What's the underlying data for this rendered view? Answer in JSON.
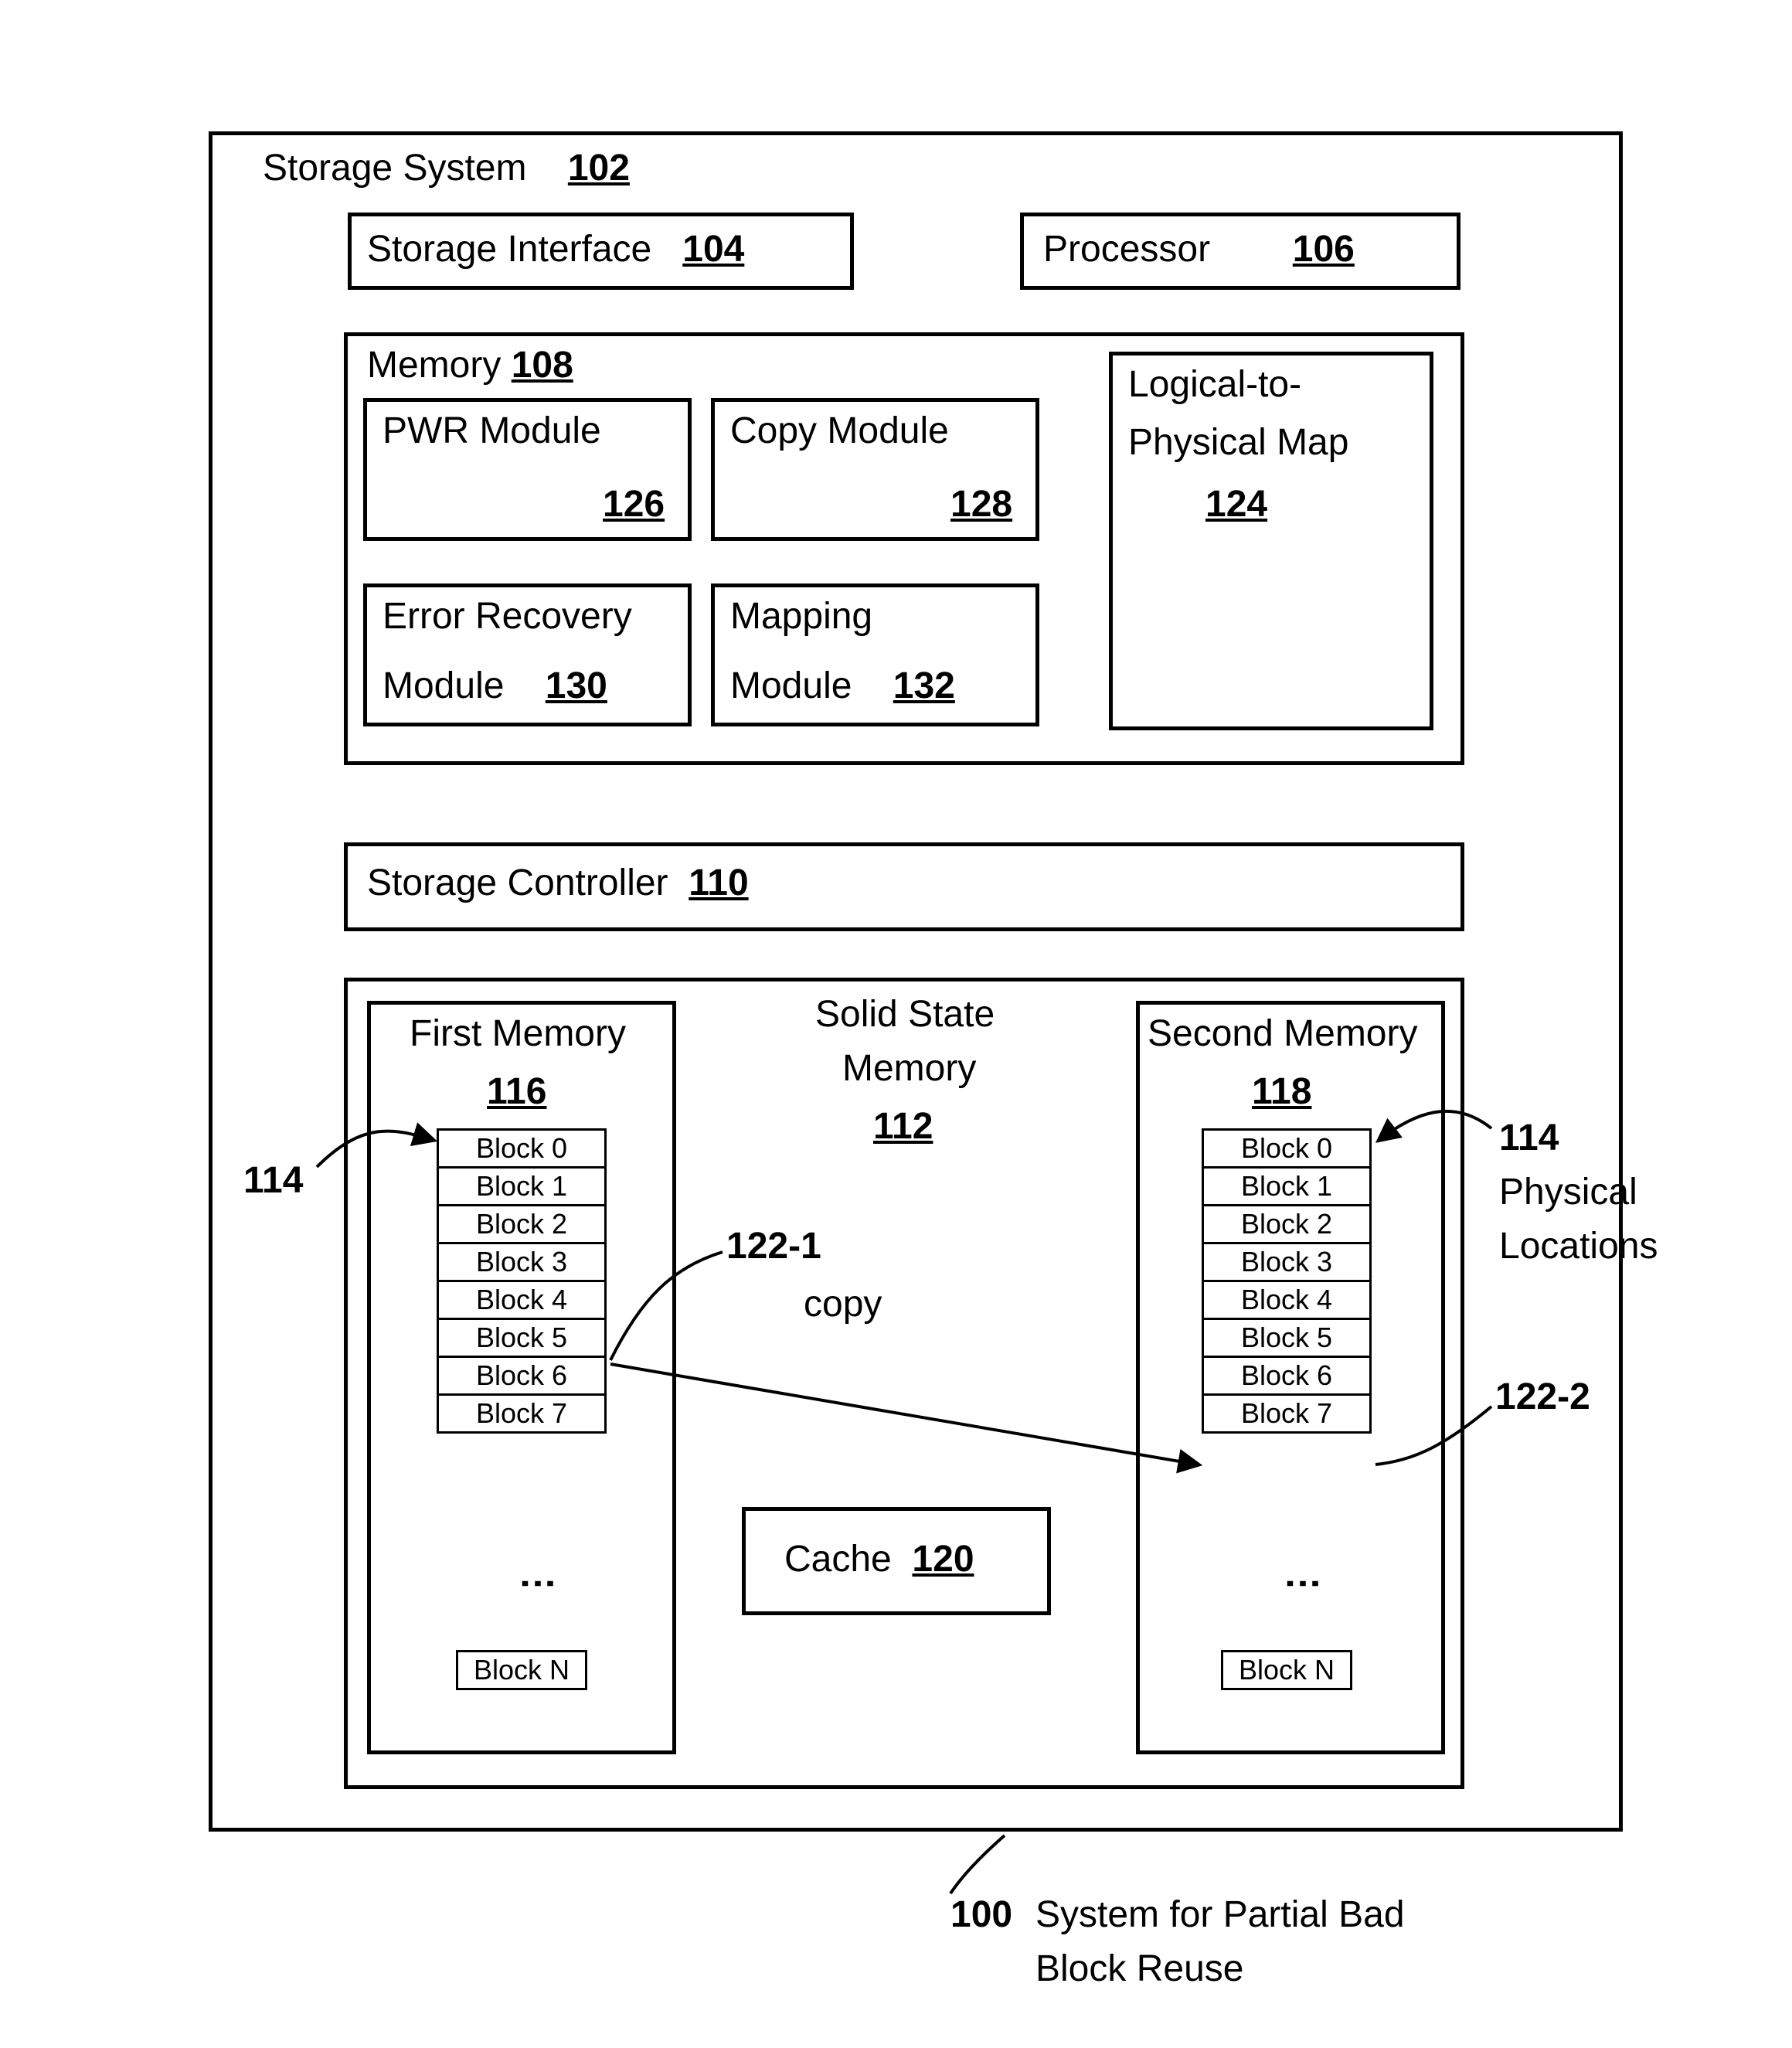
{
  "outer": {
    "title": "Storage System",
    "ref": "102"
  },
  "storage_interface": {
    "title": "Storage Interface",
    "ref": "104"
  },
  "processor": {
    "title": "Processor",
    "ref": "106"
  },
  "memory": {
    "title": "Memory",
    "ref": "108"
  },
  "pwr": {
    "line1": "PWR Module",
    "ref": "126"
  },
  "copy_module": {
    "line1": "Copy Module",
    "ref": "128"
  },
  "error_recovery": {
    "line1": "Error Recovery",
    "line2": "Module",
    "ref": "130"
  },
  "mapping_module": {
    "line1": "Mapping",
    "line2": "Module",
    "ref": "132"
  },
  "l2p": {
    "line1": "Logical-to-",
    "line2": "Physical Map",
    "ref": "124"
  },
  "storage_controller": {
    "title": "Storage Controller",
    "ref": "110"
  },
  "ssm": {
    "line1": "Solid State",
    "line2": "Memory",
    "ref": "112"
  },
  "first_memory": {
    "title": "First Memory",
    "ref": "116"
  },
  "second_memory": {
    "title": "Second Memory",
    "ref": "118"
  },
  "cache": {
    "title": "Cache",
    "ref": "120"
  },
  "blocks": [
    "Block 0",
    "Block 1",
    "Block 2",
    "Block 3",
    "Block 4",
    "Block 5",
    "Block 6",
    "Block 7"
  ],
  "block_last": "Block N",
  "callout_114_left": "114",
  "callout_114_right": {
    "num": "114",
    "line1": "Physical",
    "line2": "Locations"
  },
  "callout_122_1": "122-1",
  "callout_122_2": "122-2",
  "copy_word": "copy",
  "footer": {
    "num": "100",
    "line1": "System for Partial Bad",
    "line2": "Block Reuse"
  }
}
